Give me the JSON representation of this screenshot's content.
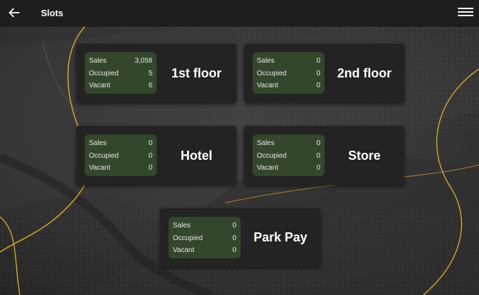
{
  "header": {
    "title": "Slots",
    "back_icon": "arrow-left-icon",
    "menu_icon": "hamburger-menu-icon"
  },
  "colors": {
    "topbar": "#1e1e1e",
    "card": "#232323",
    "stats_panel": "#33472c",
    "accent_line": "#d4a829"
  },
  "stat_labels": {
    "sales": "Sales",
    "occupied": "Occupied",
    "vacant": "Vacant"
  },
  "areas": [
    {
      "name": "1st floor",
      "sales": "3,058",
      "occupied": "5",
      "vacant": "6"
    },
    {
      "name": "2nd floor",
      "sales": "0",
      "occupied": "0",
      "vacant": "0"
    },
    {
      "name": "Hotel",
      "sales": "0",
      "occupied": "0",
      "vacant": "0"
    },
    {
      "name": "Store",
      "sales": "0",
      "occupied": "0",
      "vacant": "0"
    },
    {
      "name": "Park Pay",
      "sales": "0",
      "occupied": "0",
      "vacant": "0"
    }
  ]
}
